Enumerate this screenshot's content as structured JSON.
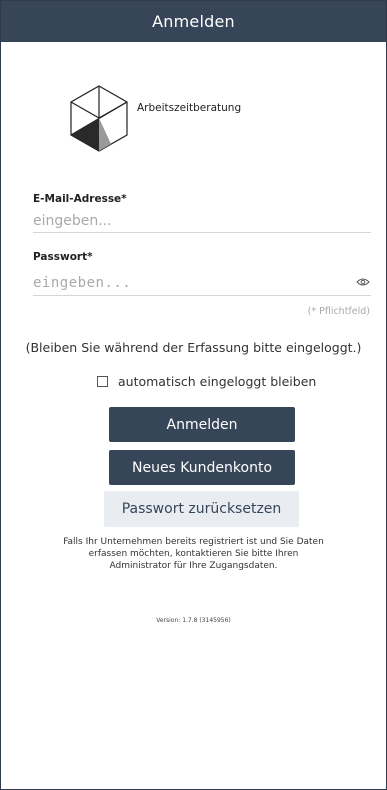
{
  "header": {
    "title": "Anmelden"
  },
  "logo": {
    "text": "Arbeitszeitberatung"
  },
  "form": {
    "email_label": "E-Mail-Adresse*",
    "email_placeholder": "eingeben...",
    "password_label": "Passwort*",
    "password_placeholder": "eingeben...",
    "required_note": "(* Pflichtfeld)"
  },
  "stay_logged_text": "(Bleiben Sie während der Erfassung bitte eingeloggt.)",
  "remember": {
    "label": "automatisch eingeloggt bleiben",
    "checked": false
  },
  "buttons": {
    "login": "Anmelden",
    "new_account": "Neues Kundenkonto",
    "reset_password": "Passwort zurücksetzen"
  },
  "info_text": "Falls Ihr Unternehmen bereits registriert ist und Sie Daten erfassen möchten, kontaktieren Sie bitte Ihren Administrator für Ihre Zugangsdaten.",
  "version": "Version: 1.7.8 (3145956)",
  "colors": {
    "primary": "#374559",
    "secondary_button": "#e9edf2",
    "placeholder": "#a9a9a9"
  }
}
